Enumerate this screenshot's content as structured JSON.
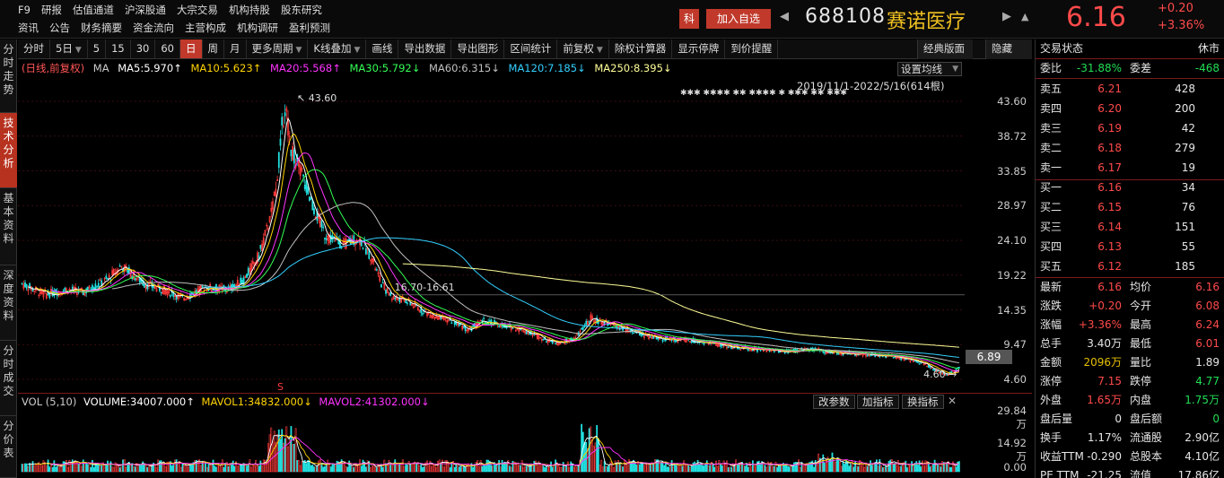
{
  "topnav": {
    "row1": [
      "F9",
      "研报",
      "估值通道",
      "沪深股通",
      "大宗交易",
      "机构持股",
      "股东研究"
    ],
    "row2": [
      "资讯",
      "公告",
      "财务摘要",
      "资金流向",
      "主营构成",
      "机构调研",
      "盈利预测"
    ],
    "ke_badge": "科",
    "add_fav": "加入自选",
    "prev_arrow": "◀",
    "next_arrow": "▶",
    "bell": "▲",
    "code": "688108",
    "name": "赛诺医疗",
    "price": "6.16",
    "change": "+0.20",
    "change_pct": "+3.36%"
  },
  "lefttabs": [
    "分时走势",
    "技术分析",
    "基本资料",
    "深度资料",
    "分时成交",
    "分价表"
  ],
  "toolbar": {
    "items": [
      "分时",
      "5日",
      "5",
      "15",
      "30",
      "60",
      "日",
      "周",
      "月",
      "更多周期",
      "K线叠加",
      "画线",
      "导出数据",
      "导出图形",
      "区间统计",
      "前复权",
      "除权计算器",
      "显示停牌",
      "到价提醒"
    ],
    "right1": "经典版面",
    "right2": "隐藏"
  },
  "maline": {
    "prefix": "(日线,前复权)",
    "ma": "MA",
    "ma5": "MA5:5.970↑",
    "ma10": "MA10:5.623↑",
    "ma20": "MA20:5.568↑",
    "ma30": "MA30:5.792↓",
    "ma60": "MA60:6.315↓",
    "ma120": "MA120:7.185↓",
    "ma250": "MA250:8.395↓"
  },
  "chart": {
    "set_avg": "设置均线",
    "date_range": "2019/11/1-2022/5/16(614根)",
    "stars": "✱✱✱ ✱✱✱✱ ✱✱ ✱✱✱✱ ✱ ✱✱✱ ✱✱ ✱✱✱",
    "peak_label": "43.60",
    "range_label": "16.70-16.61",
    "low_label": "4.60",
    "current_box": "6.89",
    "s_marker": "S",
    "price_labels": [
      "43.60",
      "38.72",
      "33.85",
      "28.97",
      "24.10",
      "19.22",
      "14.35",
      "9.47",
      "4.60"
    ],
    "colors": {
      "up": "#ff3b3b",
      "down": "#22e0e0",
      "ma5": "#ffffff",
      "ma10": "#ffd400",
      "ma20": "#ff33ff",
      "ma30": "#33ff55",
      "ma60": "#c0c0c0",
      "ma120": "#33d0ff",
      "ma250": "#ffff99"
    }
  },
  "volume": {
    "label": "VOL (5,10)",
    "volume": "VOLUME:34007.000↑",
    "mavol1": "MAVOL1:34832.000↓",
    "mavol2": "MAVOL2:41302.000↓",
    "btn1": "改参数",
    "btn2": "加指标",
    "btn3": "换指标",
    "close": "✕",
    "axis": [
      "29.84万",
      "14.92万",
      "0.00"
    ]
  },
  "panel": {
    "status_label": "交易状态",
    "status_value": "休市",
    "weibi_label": "委比",
    "weibi_value": "-31.88%",
    "weicha_label": "委差",
    "weicha_value": "-468",
    "asks": [
      {
        "label": "卖五",
        "price": "6.21",
        "vol": "428"
      },
      {
        "label": "卖四",
        "price": "6.20",
        "vol": "200"
      },
      {
        "label": "卖三",
        "price": "6.19",
        "vol": "42"
      },
      {
        "label": "卖二",
        "price": "6.18",
        "vol": "279"
      },
      {
        "label": "卖一",
        "price": "6.17",
        "vol": "19"
      }
    ],
    "bids": [
      {
        "label": "买一",
        "price": "6.16",
        "vol": "34"
      },
      {
        "label": "买二",
        "price": "6.15",
        "vol": "76"
      },
      {
        "label": "买三",
        "price": "6.14",
        "vol": "151"
      },
      {
        "label": "买四",
        "price": "6.13",
        "vol": "55"
      },
      {
        "label": "买五",
        "price": "6.12",
        "vol": "185"
      }
    ],
    "stats": [
      {
        "l1": "最新",
        "v1": "6.16",
        "c1": "red",
        "l2": "均价",
        "v2": "6.16",
        "c2": "red"
      },
      {
        "l1": "涨跌",
        "v1": "+0.20",
        "c1": "red",
        "l2": "今开",
        "v2": "6.08",
        "c2": "red"
      },
      {
        "l1": "涨幅",
        "v1": "+3.36%",
        "c1": "red",
        "l2": "最高",
        "v2": "6.24",
        "c2": "red"
      },
      {
        "l1": "总手",
        "v1": "3.40万",
        "c1": "white",
        "l2": "最低",
        "v2": "6.01",
        "c2": "red"
      },
      {
        "l1": "金额",
        "v1": "2096万",
        "c1": "yellow",
        "l2": "量比",
        "v2": "1.89",
        "c2": "white"
      },
      {
        "l1": "涨停",
        "v1": "7.15",
        "c1": "red",
        "l2": "跌停",
        "v2": "4.77",
        "c2": "green"
      },
      {
        "l1": "外盘",
        "v1": "1.65万",
        "c1": "red",
        "l2": "内盘",
        "v2": "1.75万",
        "c2": "green"
      },
      {
        "l1": "盘后量",
        "v1": "0",
        "c1": "white",
        "l2": "盘后额",
        "v2": "0",
        "c2": "green"
      },
      {
        "l1": "换手",
        "v1": "1.17%",
        "c1": "white",
        "l2": "流通股",
        "v2": "2.90亿",
        "c2": "white"
      },
      {
        "l1": "收益TTM",
        "v1": "-0.290",
        "c1": "white",
        "l2": "总股本",
        "v2": "4.10亿",
        "c2": "white"
      },
      {
        "l1": "PE TTM",
        "v1": "-21.25",
        "c1": "white",
        "l2": "流值",
        "v2": "17.86亿",
        "c2": "white"
      }
    ]
  }
}
